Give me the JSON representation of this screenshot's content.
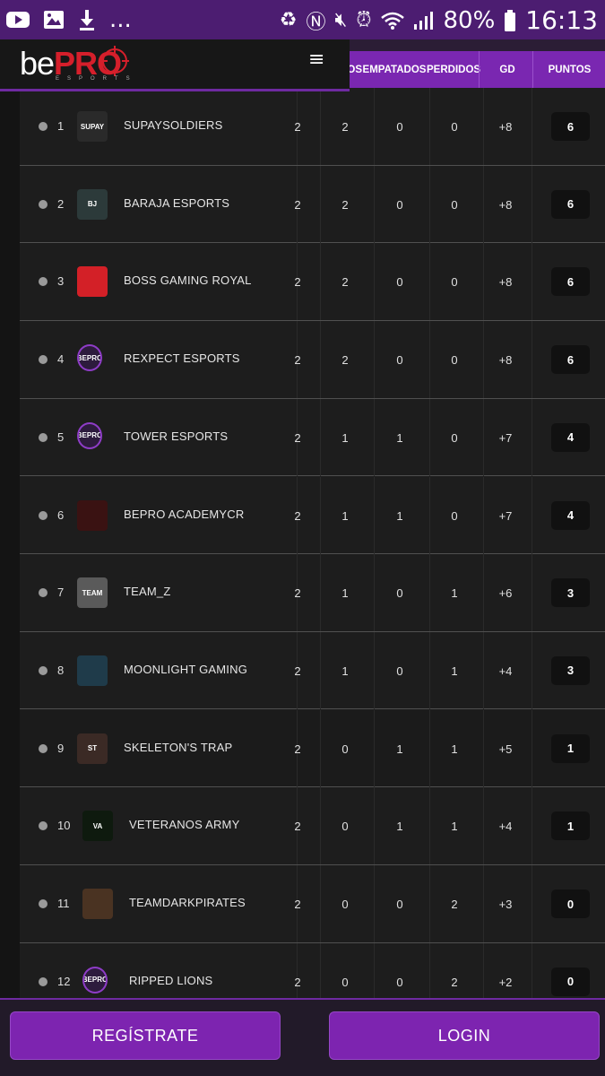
{
  "status_bar": {
    "left_icons": [
      "youtube-icon",
      "image-icon",
      "download-icon"
    ],
    "more": "...",
    "battery_pct": "80%",
    "time": "16:13"
  },
  "brand": {
    "be": "be",
    "pro": "PRO",
    "sub": "ESPORTS"
  },
  "columns": {
    "ganados_partial": "DOS",
    "empatados": "EMPATADOS",
    "perdidos": "PERDIDOS",
    "gd": "GD",
    "puntos": "PUNTOS"
  },
  "colors": {
    "accent": "#7a27b1",
    "header_dark": "#4c1d71",
    "brand_red": "#d51f2b"
  },
  "standings": [
    {
      "pos": "1",
      "team": "SUPAYSOLDIERS",
      "pj": "2",
      "g": "2",
      "e": "0",
      "p": "0",
      "gd": "+8",
      "pts": "6",
      "logo": "supay-logo",
      "logo_text": "SUPAY"
    },
    {
      "pos": "2",
      "team": "BARAJA ESPORTS",
      "pj": "2",
      "g": "2",
      "e": "0",
      "p": "0",
      "gd": "+8",
      "pts": "6",
      "logo": "baraja-logo",
      "logo_text": "BJ"
    },
    {
      "pos": "3",
      "team": "BOSS GAMING ROYAL",
      "pj": "2",
      "g": "2",
      "e": "0",
      "p": "0",
      "gd": "+8",
      "pts": "6",
      "logo": "boss-logo",
      "logo_text": ""
    },
    {
      "pos": "4",
      "team": "REXPECT ESPORTS",
      "pj": "2",
      "g": "2",
      "e": "0",
      "p": "0",
      "gd": "+8",
      "pts": "6",
      "logo": "bepro-logo",
      "logo_text": "BEPRO"
    },
    {
      "pos": "5",
      "team": "TOWER ESPORTS",
      "pj": "2",
      "g": "1",
      "e": "1",
      "p": "0",
      "gd": "+7",
      "pts": "4",
      "logo": "bepro-logo",
      "logo_text": "BEPRO"
    },
    {
      "pos": "6",
      "team": "BEPRO ACADEMYCR",
      "pj": "2",
      "g": "1",
      "e": "1",
      "p": "0",
      "gd": "+7",
      "pts": "4",
      "logo": "academy-logo",
      "logo_text": ""
    },
    {
      "pos": "7",
      "team": "TEAM_Z",
      "pj": "2",
      "g": "1",
      "e": "0",
      "p": "1",
      "gd": "+6",
      "pts": "3",
      "logo": "teamz-logo",
      "logo_text": "TEAM"
    },
    {
      "pos": "8",
      "team": "MOONLIGHT GAMING",
      "pj": "2",
      "g": "1",
      "e": "0",
      "p": "1",
      "gd": "+4",
      "pts": "3",
      "logo": "moonlight-logo",
      "logo_text": ""
    },
    {
      "pos": "9",
      "team": "SKELETON'S TRAP",
      "pj": "2",
      "g": "0",
      "e": "1",
      "p": "1",
      "gd": "+5",
      "pts": "1",
      "logo": "skeleton-logo",
      "logo_text": "ST"
    },
    {
      "pos": "10",
      "team": "VETERANOS ARMY",
      "pj": "2",
      "g": "0",
      "e": "1",
      "p": "1",
      "gd": "+4",
      "pts": "1",
      "logo": "veteranos-logo",
      "logo_text": "VA"
    },
    {
      "pos": "11",
      "team": "TEAMDARKPIRATES",
      "pj": "2",
      "g": "0",
      "e": "0",
      "p": "2",
      "gd": "+3",
      "pts": "0",
      "logo": "pirates-logo",
      "logo_text": ""
    },
    {
      "pos": "12",
      "team": "RIPPED LIONS",
      "pj": "2",
      "g": "0",
      "e": "0",
      "p": "2",
      "gd": "+2",
      "pts": "0",
      "logo": "bepro-logo",
      "logo_text": "BEPRO"
    }
  ],
  "buttons": {
    "register": "REGÍSTRATE",
    "login": "LOGIN"
  }
}
